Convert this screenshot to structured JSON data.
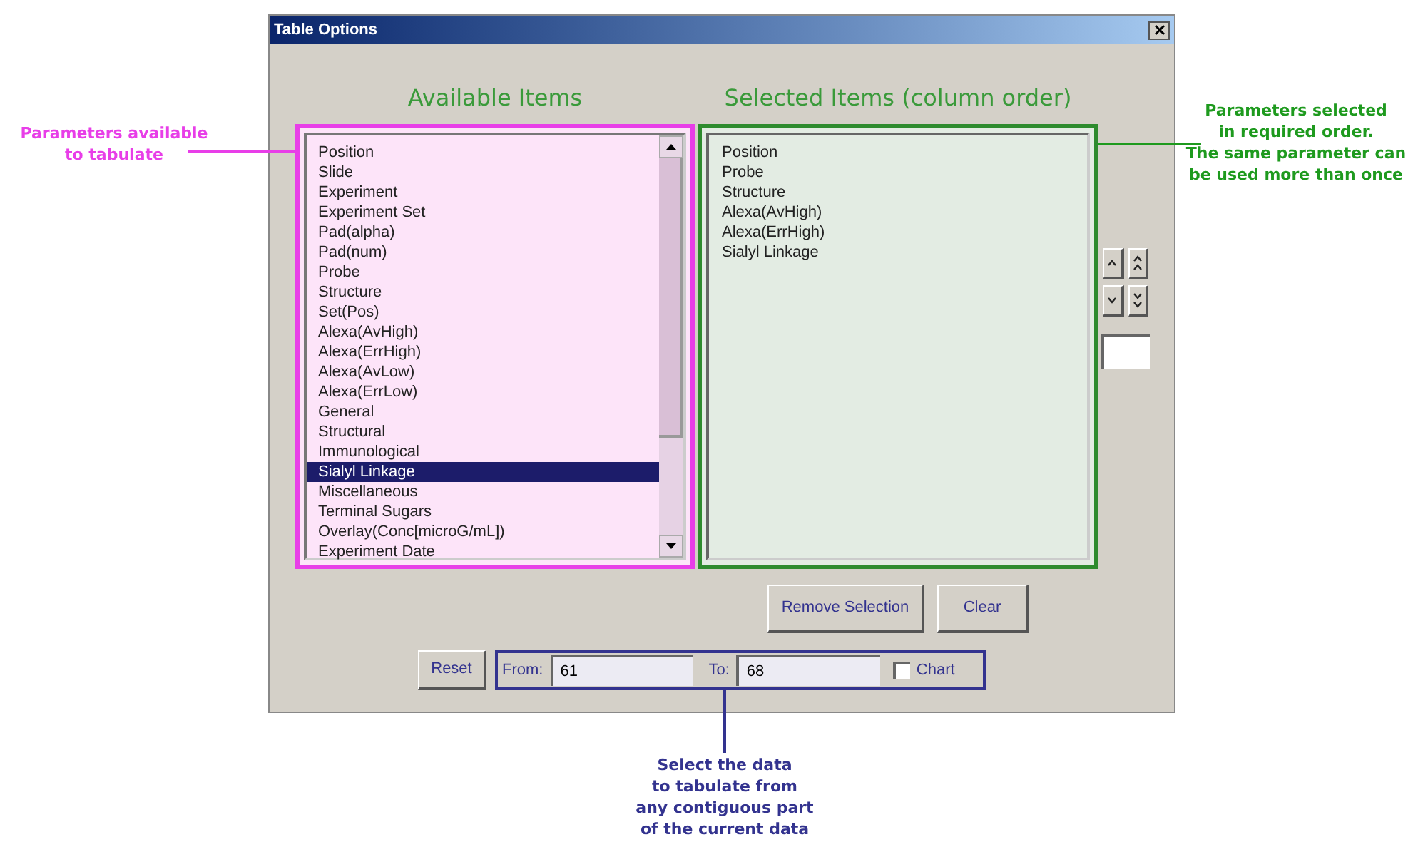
{
  "window": {
    "title": "Table Options"
  },
  "available": {
    "heading": "Available Items",
    "items": [
      {
        "label": "Position",
        "selected": false
      },
      {
        "label": "Slide",
        "selected": false
      },
      {
        "label": "Experiment",
        "selected": false
      },
      {
        "label": "Experiment Set",
        "selected": false
      },
      {
        "label": "Pad(alpha)",
        "selected": false
      },
      {
        "label": "Pad(num)",
        "selected": false
      },
      {
        "label": "Probe",
        "selected": false
      },
      {
        "label": "Structure",
        "selected": false
      },
      {
        "label": "Set(Pos)",
        "selected": false
      },
      {
        "label": "Alexa(AvHigh)",
        "selected": false
      },
      {
        "label": "Alexa(ErrHigh)",
        "selected": false
      },
      {
        "label": "Alexa(AvLow)",
        "selected": false
      },
      {
        "label": "Alexa(ErrLow)",
        "selected": false
      },
      {
        "label": "General",
        "selected": false
      },
      {
        "label": "Structural",
        "selected": false
      },
      {
        "label": "Immunological",
        "selected": false
      },
      {
        "label": "Sialyl Linkage",
        "selected": true
      },
      {
        "label": "Miscellaneous",
        "selected": false
      },
      {
        "label": "Terminal Sugars",
        "selected": false
      },
      {
        "label": "Overlay(Conc[microG/mL])",
        "selected": false
      },
      {
        "label": "Experiment Date",
        "selected": false
      }
    ]
  },
  "selected_items": {
    "heading": "Selected Items (column order)",
    "items": [
      "Position",
      "Probe",
      "Structure",
      "Alexa(AvHigh)",
      "Alexa(ErrHigh)",
      "Sialyl Linkage"
    ]
  },
  "buttons": {
    "remove": "Remove Selection",
    "clear": "Clear",
    "reset": "Reset"
  },
  "range": {
    "from_label": "From:",
    "from_value": "61",
    "to_label": "To:",
    "to_value": "68",
    "chart": {
      "label": "Chart",
      "checked": false
    }
  },
  "annotations": [
    {
      "kind": "left",
      "color": "#e83ee8",
      "text": "Parameters available\nto tabulate"
    },
    {
      "kind": "right",
      "color": "#1e9a1e",
      "text": "Parameters selected\nin required order.\nThe same parameter can\nbe used more than once"
    },
    {
      "kind": "bottom",
      "color": "#33338f",
      "text": "Select the data\nto tabulate from\nany contiguous part\nof the current data"
    }
  ]
}
